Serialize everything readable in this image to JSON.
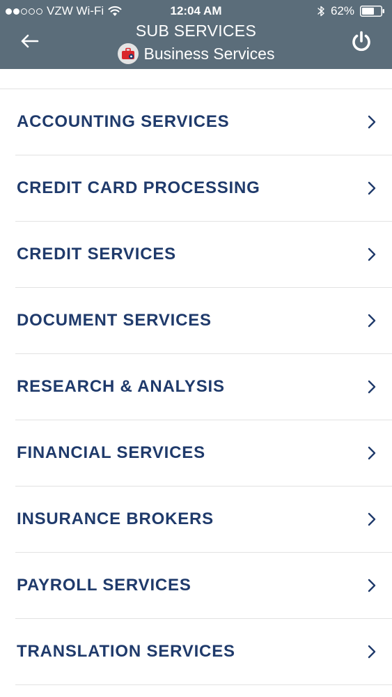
{
  "status_bar": {
    "carrier": "VZW Wi-Fi",
    "time": "12:04 AM",
    "battery": "62%"
  },
  "nav": {
    "title": "SUB SERVICES",
    "subtitle": "Business Services",
    "back_icon": "arrow-left-icon",
    "power_icon": "power-icon",
    "category_icon": "briefcase-icon"
  },
  "colors": {
    "header_bg": "#5b6d7a",
    "item_text": "#1f3a6b",
    "divider": "#e2e2e2"
  },
  "items": [
    {
      "label": "ACCOUNTING SERVICES"
    },
    {
      "label": "CREDIT CARD PROCESSING"
    },
    {
      "label": "CREDIT SERVICES"
    },
    {
      "label": "DOCUMENT SERVICES"
    },
    {
      "label": "RESEARCH & ANALYSIS"
    },
    {
      "label": "FINANCIAL SERVICES"
    },
    {
      "label": "INSURANCE BROKERS"
    },
    {
      "label": "PAYROLL SERVICES"
    },
    {
      "label": "TRANSLATION SERVICES"
    }
  ]
}
